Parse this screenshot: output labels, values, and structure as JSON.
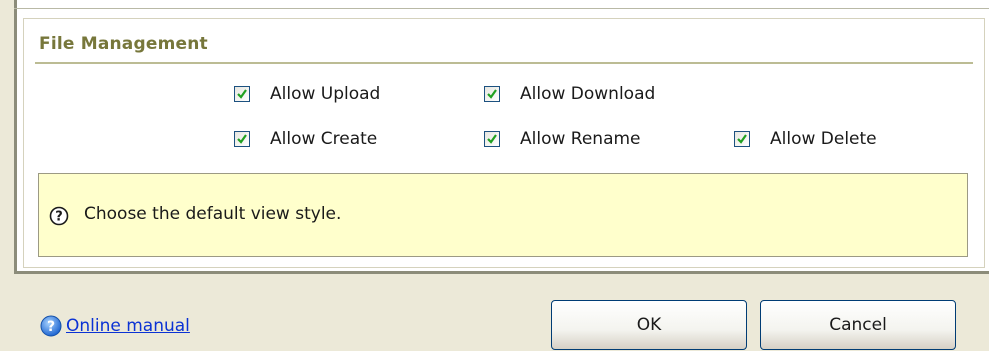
{
  "section": {
    "title": "File Management"
  },
  "options": {
    "upload": {
      "label": "Allow Upload",
      "checked": true
    },
    "download": {
      "label": "Allow Download",
      "checked": true
    },
    "create": {
      "label": "Allow Create",
      "checked": true
    },
    "rename": {
      "label": "Allow Rename",
      "checked": true
    },
    "delete": {
      "label": "Allow Delete",
      "checked": true
    }
  },
  "help": {
    "text": "Choose the default view style.",
    "icon": "question-circle-icon"
  },
  "footer": {
    "manual_label": "Online manual",
    "manual_icon": "help-globe-icon",
    "ok_label": "OK",
    "cancel_label": "Cancel"
  },
  "colors": {
    "header": "#77773b",
    "help_bg": "#ffffcc",
    "link": "#0b32d4",
    "check": "#21a121"
  }
}
